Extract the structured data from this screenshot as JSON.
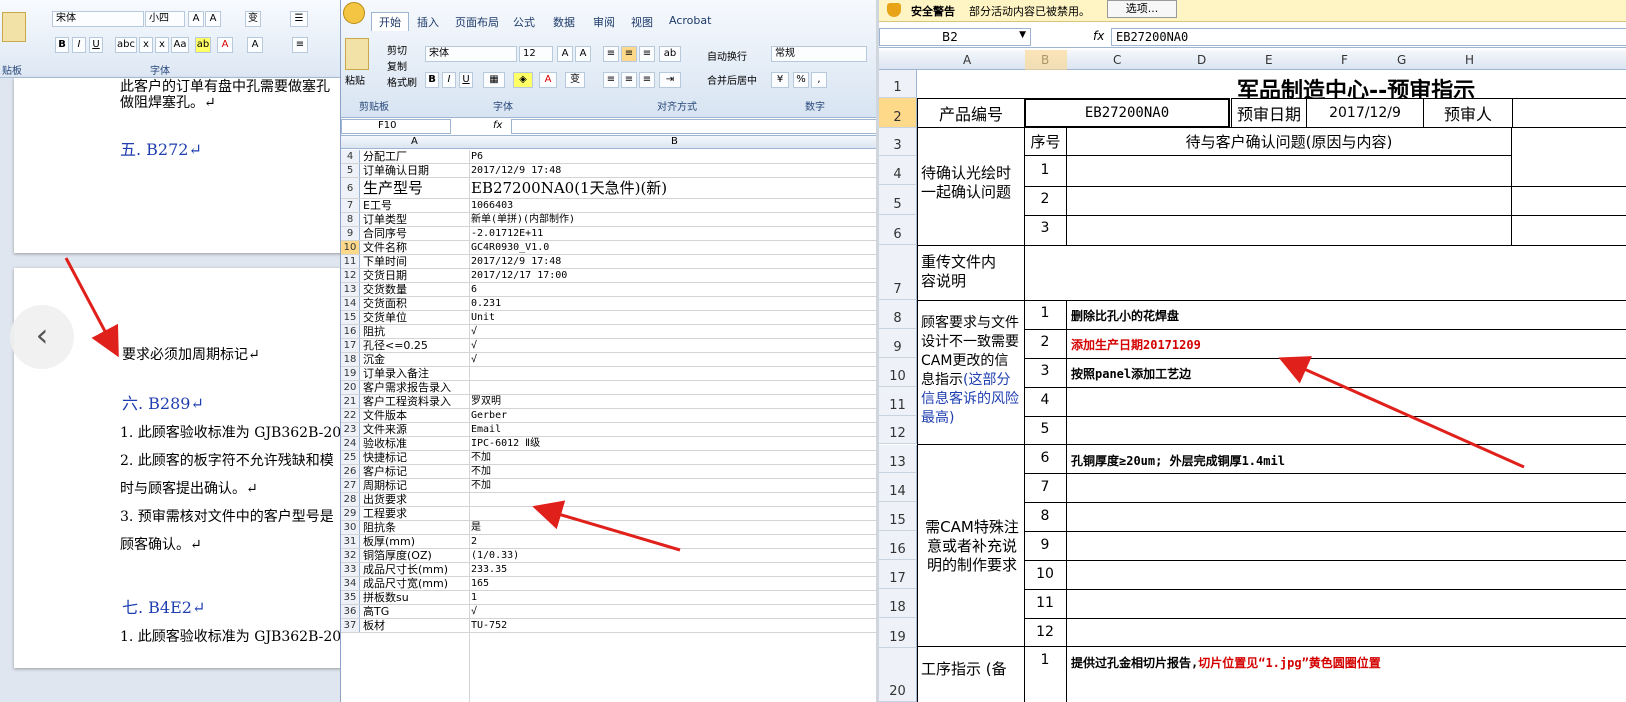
{
  "word": {
    "font_name": "宋体",
    "font_size": "小四",
    "clipboard_label": "贴板",
    "font_group": "字体",
    "page1_lines": [
      "此客户的订单有盘中孔需要做塞孔",
      "做阻焊塞孔。↵"
    ],
    "heading5": "五. B272↵",
    "note_line": "要求必须加周期标记↵",
    "heading6": "六. B289↵",
    "item1": "1. 此顾客验收标准为 GJB362B-20",
    "item2": "2. 此顾客的板字符不允许残缺和模",
    "item2b": "时与顾客提出确认。↵",
    "item3": "3. 预审需核对文件中的客户型号是",
    "item3b": "顾客确认。↵",
    "heading7": "七. B4E2↵",
    "item7_1": "1. 此顾客验收标准为 GJB362B-20"
  },
  "excel1": {
    "tabs": [
      "开始",
      "插入",
      "页面布局",
      "公式",
      "数据",
      "审阅",
      "视图",
      "Acrobat"
    ],
    "paste": "粘贴",
    "cut": "剪切",
    "copy": "复制",
    "format_painter": "格式刷",
    "clipboard_group": "剪贴板",
    "font_name": "宋体",
    "font_size": "12",
    "font_group": "字体",
    "wrap_text": "自动换行",
    "merge_center": "合并后居中",
    "align_group": "对齐方式",
    "number_format": "常规",
    "number_group": "数字",
    "name_box": "F10",
    "fx": "fx",
    "col_a": "A",
    "col_b": "B",
    "rows": [
      {
        "n": "4",
        "a": "分配工厂",
        "b": "P6"
      },
      {
        "n": "5",
        "a": "订单确认日期",
        "b": "2017/12/9 17:48"
      },
      {
        "n": "6",
        "a": "生产型号",
        "b": "EB27200NA0(1天急件)(新)"
      },
      {
        "n": "7",
        "a": "E工号",
        "b": "1066403"
      },
      {
        "n": "8",
        "a": "订单类型",
        "b": "新单(单拼)(内部制作)"
      },
      {
        "n": "9",
        "a": "合同序号",
        "b": "-2.01712E+11"
      },
      {
        "n": "10",
        "a": "文件名称",
        "b": "GC4R0930_V1.0"
      },
      {
        "n": "11",
        "a": "下单时间",
        "b": "2017/12/9 17:48"
      },
      {
        "n": "12",
        "a": "交货日期",
        "b": "2017/12/17 17:00"
      },
      {
        "n": "13",
        "a": "交货数量",
        "b": "6"
      },
      {
        "n": "14",
        "a": "交货面积",
        "b": "0.231"
      },
      {
        "n": "15",
        "a": "交货单位",
        "b": "Unit"
      },
      {
        "n": "16",
        "a": "阻抗",
        "b": "√"
      },
      {
        "n": "17",
        "a": "孔径<=0.25",
        "b": "√"
      },
      {
        "n": "18",
        "a": "沉金",
        "b": "√"
      },
      {
        "n": "19",
        "a": "订单录入备注",
        "b": ""
      },
      {
        "n": "20",
        "a": "客户需求报告录入",
        "b": ""
      },
      {
        "n": "21",
        "a": "客户工程资料录入",
        "b": "罗双明"
      },
      {
        "n": "22",
        "a": "文件版本",
        "b": "Gerber"
      },
      {
        "n": "23",
        "a": "文件来源",
        "b": "Email"
      },
      {
        "n": "24",
        "a": "验收标准",
        "b": "IPC-6012 Ⅱ级"
      },
      {
        "n": "25",
        "a": "快捷标记",
        "b": "不加"
      },
      {
        "n": "26",
        "a": "客户标记",
        "b": "不加"
      },
      {
        "n": "27",
        "a": "周期标记",
        "b": "不加"
      },
      {
        "n": "28",
        "a": "出货要求",
        "b": ""
      },
      {
        "n": "29",
        "a": "工程要求",
        "b": ""
      },
      {
        "n": "30",
        "a": "阻抗条",
        "b": "是"
      },
      {
        "n": "31",
        "a": "板厚(mm)",
        "b": "2"
      },
      {
        "n": "32",
        "a": "铜箔厚度(OZ)",
        "b": "(1/0.33)"
      },
      {
        "n": "33",
        "a": "成品尺寸长(mm)",
        "b": "233.35"
      },
      {
        "n": "34",
        "a": "成品尺寸宽(mm)",
        "b": "165"
      },
      {
        "n": "35",
        "a": "拼板数su",
        "b": "1"
      },
      {
        "n": "36",
        "a": "高TG",
        "b": "√"
      },
      {
        "n": "37",
        "a": "板材",
        "b": "TU-752"
      }
    ]
  },
  "excel2": {
    "security_warning": "安全警告",
    "warning_text": "部分活动内容已被禁用。",
    "options_button": "选项...",
    "name_box": "B2",
    "fx": "fx",
    "formula_value": "EB27200NA0",
    "columns": [
      "A",
      "B",
      "C",
      "D",
      "E",
      "F",
      "G",
      "H"
    ],
    "row_numbers": [
      "1",
      "2",
      "3",
      "4",
      "5",
      "6",
      "7",
      "8",
      "9",
      "10",
      "11",
      "12",
      "13",
      "14",
      "15",
      "16",
      "17",
      "18",
      "19",
      "20"
    ],
    "title": "军品制造中心--预审指示",
    "product_no_label": "产品编号",
    "product_no": "EB27200NA0",
    "review_date_label": "预审日期",
    "review_date": "2017/12/9",
    "reviewer_label": "预审人",
    "seq_header": "序号",
    "issue_header": "待与客户确认问题(原因与内容)",
    "section1": "待确认光绘时一起确认问题",
    "section1_nums": [
      "1",
      "2",
      "3"
    ],
    "section2": "重传文件内容说明",
    "section3_black": "顾客要求与文件设计不一致需要CAM更改的信息指示",
    "section3_blue": "(这部分信息客诉的风险最高)",
    "section3_nums": [
      "1",
      "2",
      "3",
      "4",
      "5"
    ],
    "section3_items": [
      "删除比孔小的花焊盘",
      "添加生产日期20171209",
      "按照panel添加工艺边",
      "",
      ""
    ],
    "section4": "需CAM特殊注意或者补充说明的制作要求",
    "section4_nums": [
      "6",
      "7",
      "8",
      "9",
      "10",
      "11",
      "12"
    ],
    "section4_items": [
      "孔铜厚度≥20um; 外层完成铜厚1.4mil",
      "",
      "",
      "",
      "",
      "",
      ""
    ],
    "section5": "工序指示 (备",
    "section5_num": "1",
    "section5_item_black": "提供过孔金相切片报告,",
    "section5_item_red": "切片位置见“1.jpg”黄色圆圈位置"
  },
  "colors": {
    "red_text": "#d40000",
    "blue_text": "#1f3fb0",
    "arrow": "#e0201a",
    "warning_bar": "#fff4c4"
  }
}
